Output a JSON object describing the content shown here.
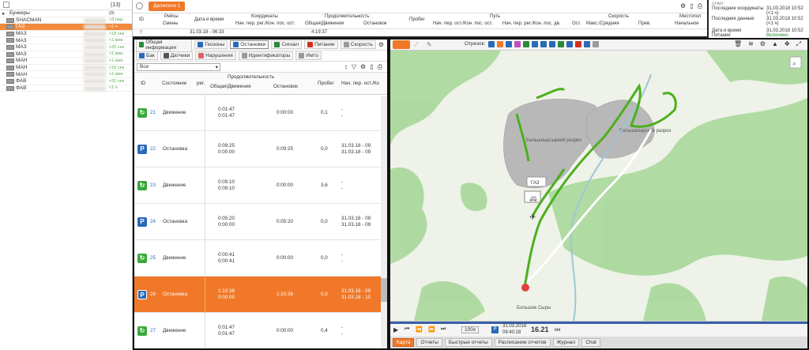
{
  "tree": {
    "header_count": "(13)",
    "group_label": "Бункеры",
    "group_count": "(0)",
    "units": [
      {
        "name": "SHACMAN",
        "count": "<3 нед",
        "selected": false
      },
      {
        "name": "ГАЗ",
        "count": "<1 ч",
        "selected": true
      },
      {
        "name": "МАЗ",
        "count": "<18 сек",
        "selected": false
      },
      {
        "name": "МАЗ",
        "count": "<1 мин",
        "selected": false
      },
      {
        "name": "МАЗ",
        "count": "<20 сек",
        "selected": false
      },
      {
        "name": "МАЗ",
        "count": "<1 мин",
        "selected": false
      },
      {
        "name": "МАН",
        "count": "<1 мин",
        "selected": false
      },
      {
        "name": "МАН",
        "count": "<16 сек",
        "selected": false
      },
      {
        "name": "МАН",
        "count": "<1 мин",
        "selected": false
      },
      {
        "name": "ФАВ",
        "count": "<31 сек",
        "selected": false
      },
      {
        "name": "ФАВ",
        "count": "<1 ч",
        "selected": false
      }
    ]
  },
  "report": {
    "tab": "Делители 1",
    "headers": {
      "id": "ID",
      "trips": "Рейсы",
      "shifts": "Смены",
      "datetime": "Дата и время",
      "coords": "Координаты",
      "coords_sub": "Нач. пер. рег./Кон. пос. ост.",
      "duration": "Продолжительность",
      "duration_sub1": "Общая/Движения",
      "duration_sub2": "Остановок",
      "mileage": "Пробег",
      "path": "Путь",
      "path_sub1": "Нач. пер. ост./Кон. пос. ост.",
      "path_sub2": "Нач. пер. рег./Кон. пос. дв.",
      "stops": "Ост.",
      "speed": "Скорость",
      "speed_sub1": "Макс./Средняя",
      "speed_sub2": "Прев.",
      "places": "Местопол",
      "places_sub": "Начальное"
    },
    "row_date": "31.03.18 - 06:33",
    "row_dur": "4:19:37"
  },
  "info": {
    "line0": "ответ",
    "last_coords_label": "Последние координаты",
    "last_coords_val": "31.03.2018 10:52 (<1 ч)",
    "last_data_label": "Последние данные",
    "last_data_val": "31.03.2018 10:52 (<1 ч)",
    "dt_label": "Дата и время",
    "dt_val": "31.03.2018 10:52",
    "type_label": "Питание",
    "type_val": "Включено"
  },
  "panel": {
    "tabs": [
      {
        "label": "Общая информация",
        "color": "#2a8a3a"
      },
      {
        "label": "Геозоны",
        "color": "#2a6ab8"
      },
      {
        "label": "Остановки",
        "color": "#2a6ab8"
      },
      {
        "label": "Сигнал",
        "color": "#2a8a3a"
      },
      {
        "label": "Питание",
        "color": "#d03020"
      },
      {
        "label": "Скорость",
        "color": "#999"
      }
    ],
    "tabs2": [
      {
        "label": "Бак",
        "color": "#2a6ab8"
      },
      {
        "label": "Датчики",
        "color": "#555"
      },
      {
        "label": "Нарушения",
        "color": "#e06060"
      },
      {
        "label": "Идентификаторы",
        "color": "#999"
      },
      {
        "label": "Имто",
        "color": "#999"
      }
    ],
    "filter": "Все",
    "col_id": "ID",
    "col_state": "Состояние",
    "col_duration": "Продолжительность",
    "col_reg": "рег.",
    "col_total": "Общая/Движения",
    "col_stops": "Остановок",
    "col_mileage": "Пробег",
    "col_start": "Нач. пер. ост./Ко",
    "rows": [
      {
        "id": "21",
        "type": "move",
        "state": "Движение",
        "total": "0:01:47",
        "total2": "0:01:47",
        "stops": "0:00:00",
        "mileage": "0,1",
        "start": "-",
        "start2": "-",
        "selected": false
      },
      {
        "id": "22",
        "type": "stop",
        "state": "Остановка",
        "total": "0:09:25",
        "total2": "0:00:00",
        "stops": "0:09:25",
        "mileage": "0,0",
        "start": "31.03.18 - 09",
        "start2": "31.03.18 - 09",
        "selected": false
      },
      {
        "id": "23",
        "type": "move",
        "state": "Движение",
        "total": "0:09:10",
        "total2": "0:09:10",
        "stops": "0:00:00",
        "mileage": "3,6",
        "start": "-",
        "start2": "-",
        "selected": false
      },
      {
        "id": "24",
        "type": "stop",
        "state": "Остановка",
        "total": "0:05:20",
        "total2": "0:00:00",
        "stops": "0:05:20",
        "mileage": "0,0",
        "start": "31.03.18 - 09",
        "start2": "31.03.18 - 09",
        "selected": false
      },
      {
        "id": "25",
        "type": "move",
        "state": "Движение",
        "total": "0:00:41",
        "total2": "0:00:41",
        "stops": "0:00:00",
        "mileage": "0,0",
        "start": "-",
        "start2": "-",
        "selected": false
      },
      {
        "id": "26",
        "type": "stop",
        "state": "Остановка",
        "total": "1:10:38",
        "total2": "0:00:00",
        "stops": "1:10:38",
        "mileage": "0,0",
        "start": "31.03.18 - 09",
        "start2": "31.03.18 - 10",
        "selected": true
      },
      {
        "id": "27",
        "type": "move",
        "state": "Движение",
        "total": "0:01:47",
        "total2": "0:01:47",
        "stops": "0:00:00",
        "mileage": "0,4",
        "start": "-",
        "start2": "-",
        "selected": false
      }
    ]
  },
  "map": {
    "toolbar_label": "Отрезок:",
    "quarry1": "Большеырсыркий разрез",
    "quarry2": "Большесырский разрез",
    "vehicle": "ГАЗ",
    "town": "Большие Сыры",
    "speed": "100x",
    "date": "31.03.2018",
    "time": "09:40:28",
    "distance": "16.21",
    "distance_unit": "км",
    "bottom_tabs": [
      "Карта",
      "Отчеты",
      "Быстрые отчеты",
      "Расписание отчетов",
      "Журнал",
      "Chat"
    ]
  }
}
